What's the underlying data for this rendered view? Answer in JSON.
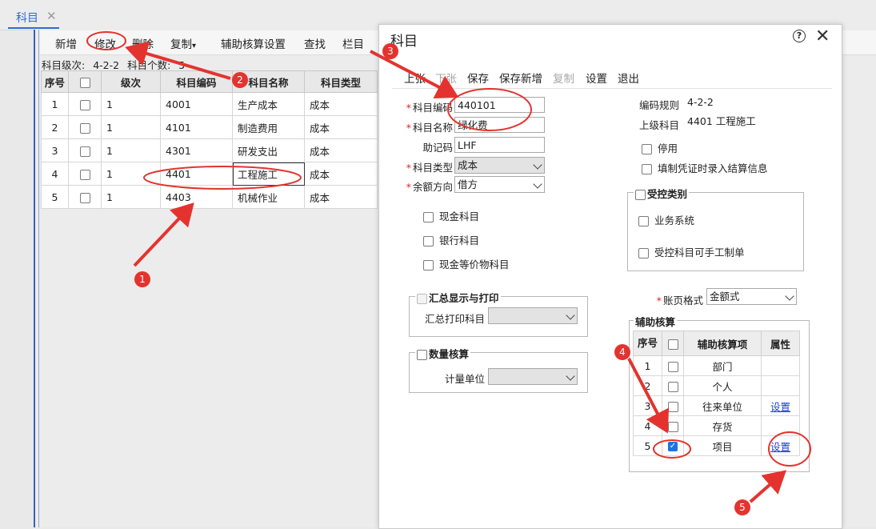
{
  "tab": {
    "label": "科目",
    "close": "✕"
  },
  "toolbar": {
    "items": [
      "新增",
      "修改",
      "删除",
      "复制",
      "辅助核算设置",
      "查找",
      "栏目"
    ]
  },
  "info": {
    "level_label": "科目级次:",
    "level_value": "4-2-2",
    "count_label": "科目个数:",
    "count_value": "5"
  },
  "grid": {
    "headers": [
      "序号",
      "",
      "级次",
      "科目编码",
      "科目名称",
      "科目类型"
    ],
    "rows": [
      {
        "no": "1",
        "level": "1",
        "code": "4001",
        "name": "生产成本",
        "type": "成本"
      },
      {
        "no": "2",
        "level": "1",
        "code": "4101",
        "name": "制造费用",
        "type": "成本"
      },
      {
        "no": "3",
        "level": "1",
        "code": "4301",
        "name": "研发支出",
        "type": "成本"
      },
      {
        "no": "4",
        "level": "1",
        "code": "4401",
        "name": "工程施工",
        "type": "成本"
      },
      {
        "no": "5",
        "level": "1",
        "code": "4403",
        "name": "机械作业",
        "type": "成本"
      }
    ]
  },
  "dialog": {
    "title": "科目",
    "help": "?",
    "close": "✕",
    "buttons": [
      "上张",
      "下张",
      "保存",
      "保存新增",
      "复制",
      "设置",
      "退出"
    ],
    "fields": {
      "code_label": "科目编码",
      "code_value": "440101",
      "name_label": "科目名称",
      "name_value": "绿化费",
      "mnemonic_label": "助记码",
      "mnemonic_value": "LHF",
      "type_label": "科目类型",
      "type_value": "成本",
      "balance_label": "余额方向",
      "balance_value": "借方"
    },
    "rule_label": "编码规则",
    "rule_value": "4-2-2",
    "parent_label": "上级科目",
    "parent_value": "4401 工程施工",
    "disable_label": "停用",
    "voucher_settle_label": "填制凭证时录入结算信息",
    "cash_label": "现金科目",
    "bank_label": "银行科目",
    "cash_equiv_label": "现金等价物科目",
    "controlled": {
      "legend": "受控类别",
      "business": "业务系统",
      "manual": "受控科目可手工制单"
    },
    "summary": {
      "legend": "汇总显示与打印",
      "print_label": "汇总打印科目"
    },
    "quantity": {
      "legend": "数量核算",
      "unit_label": "计量单位"
    },
    "ledger_label": "账页格式",
    "ledger_value": "金额式",
    "aux": {
      "legend": "辅助核算",
      "headers": [
        "序号",
        "",
        "辅助核算项",
        "属性"
      ],
      "rows": [
        {
          "no": "1",
          "item": "部门",
          "attr": "",
          "checked": false
        },
        {
          "no": "2",
          "item": "个人",
          "attr": "",
          "checked": false
        },
        {
          "no": "3",
          "item": "往来单位",
          "attr": "设置",
          "checked": false
        },
        {
          "no": "4",
          "item": "存货",
          "attr": "",
          "checked": false
        },
        {
          "no": "5",
          "item": "项目",
          "attr": "设置",
          "checked": true
        }
      ]
    }
  },
  "annotations": {
    "badges": [
      "1",
      "2",
      "3",
      "4",
      "5"
    ],
    "color": "#e4332f"
  },
  "colors": {
    "accent": "#2a6fd1",
    "link": "#1f3fd0",
    "required": "#e02020"
  }
}
